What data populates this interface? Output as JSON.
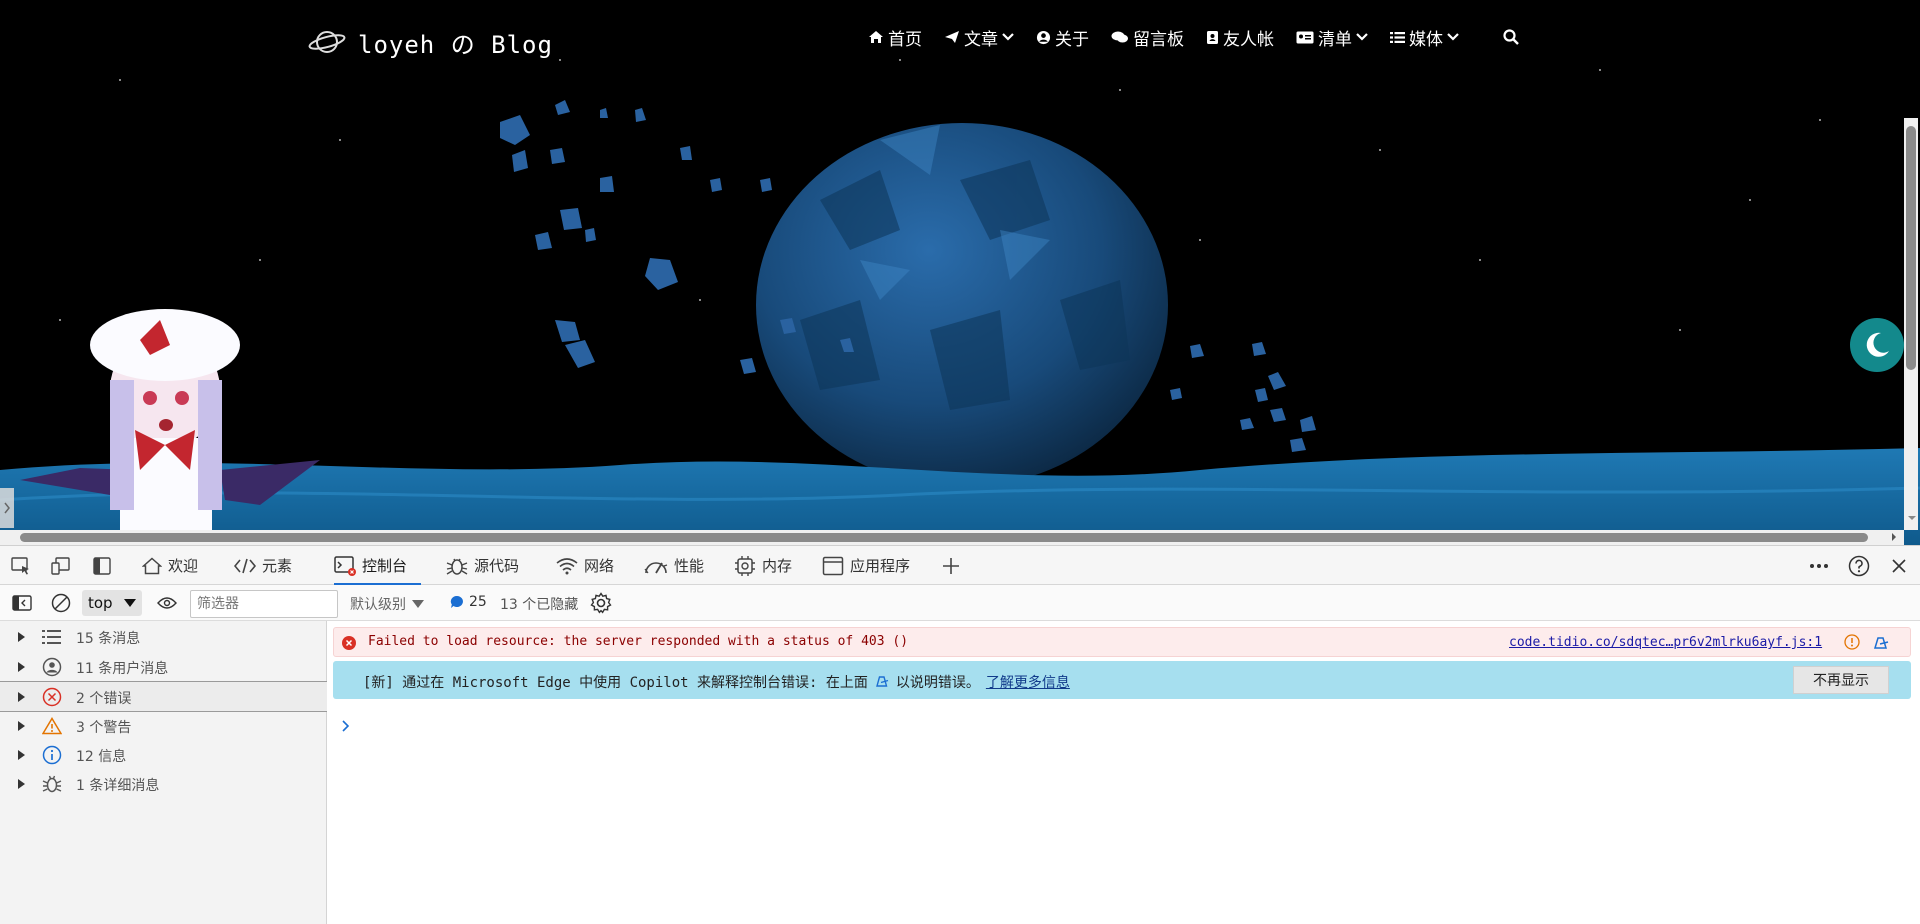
{
  "site": {
    "logo_text": "loyeh の Blog",
    "nav": [
      {
        "label": "首页",
        "icon": "home-icon",
        "dropdown": false
      },
      {
        "label": "文章",
        "icon": "paper-plane-icon",
        "dropdown": true
      },
      {
        "label": "关于",
        "icon": "user-circle-icon",
        "dropdown": false
      },
      {
        "label": "留言板",
        "icon": "comments-icon",
        "dropdown": false
      },
      {
        "label": "友人帐",
        "icon": "address-book-icon",
        "dropdown": false
      },
      {
        "label": "清单",
        "icon": "id-card-icon",
        "dropdown": true
      },
      {
        "label": "媒体",
        "icon": "list-icon",
        "dropdown": true
      }
    ],
    "search_icon": "search-icon",
    "theme_toggle_icon": "moon-icon",
    "colors": {
      "sky": "#000000",
      "planet": "#1d5a8e",
      "ocean": "#1a6aa0",
      "toggle": "#13898c"
    }
  },
  "devtools": {
    "tabs": [
      {
        "label": "欢迎",
        "icon": "home-icon"
      },
      {
        "label": "元素",
        "icon": "code-icon"
      },
      {
        "label": "控制台",
        "icon": "console-icon",
        "active": true
      },
      {
        "label": "源代码",
        "icon": "bug-icon"
      },
      {
        "label": "网络",
        "icon": "wifi-icon"
      },
      {
        "label": "性能",
        "icon": "performance-icon"
      },
      {
        "label": "内存",
        "icon": "chip-icon"
      },
      {
        "label": "应用程序",
        "icon": "window-icon"
      }
    ],
    "toolbar": {
      "context": "top",
      "filter_placeholder": "筛选器",
      "level": "默认级别",
      "message_count": "25",
      "hidden": "13 个已隐藏"
    },
    "sidebar": [
      {
        "label": "15 条消息",
        "icon": "list-icon"
      },
      {
        "label": "11 条用户消息",
        "icon": "user-circle-icon"
      },
      {
        "label": "2 个错误",
        "icon": "error-icon",
        "selected": true
      },
      {
        "label": "3 个警告",
        "icon": "warning-icon"
      },
      {
        "label": "12 信息",
        "icon": "info-icon"
      },
      {
        "label": "1 条详细消息",
        "icon": "bug-icon"
      }
    ],
    "console": {
      "error_text": "Failed to load resource: the server responded with a status of 403 ()",
      "error_source": "code.tidio.co/sdqtec…pr6v2mlrku6ayf.js:1",
      "info_prefix": "[新] 通过在 Microsoft Edge 中使用 Copilot 来解释控制台错误: 在上面",
      "info_suffix": "以说明错误。",
      "info_link": "了解更多信息",
      "dismiss": "不再显示"
    }
  }
}
